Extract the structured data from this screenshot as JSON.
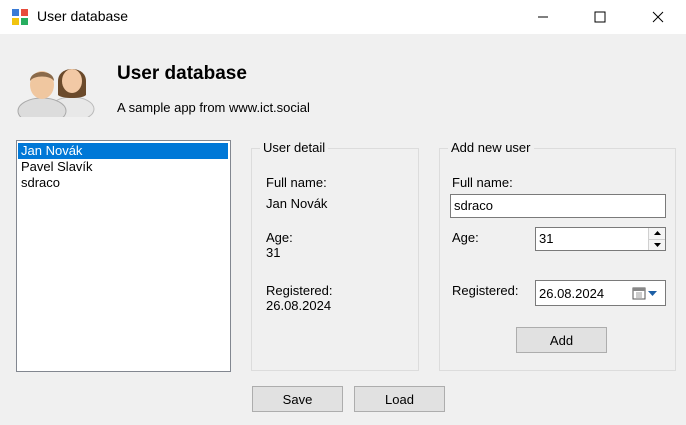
{
  "window": {
    "title": "User database",
    "controls": {
      "minimize": "minimize",
      "maximize": "maximize",
      "close": "close"
    }
  },
  "header": {
    "icon": "users-icon",
    "title": "User database",
    "subtitle": "A sample app from www.ict.social"
  },
  "user_list": {
    "items": [
      "Jan Novák",
      "Pavel Slavík",
      "sdraco"
    ],
    "selected_index": 0
  },
  "user_detail": {
    "legend": "User detail",
    "fullname_label": "Full name:",
    "fullname_value": "Jan Novák",
    "age_label": "Age:",
    "age_value": "31",
    "registered_label": "Registered:",
    "registered_value": "26.08.2024"
  },
  "add_user": {
    "legend": "Add new user",
    "fullname_label": "Full name:",
    "fullname_value": "sdraco",
    "age_label": "Age:",
    "age_value": "31",
    "registered_label": "Registered:",
    "registered_value": "26.08.2024",
    "add_label": "Add"
  },
  "buttons": {
    "save": "Save",
    "load": "Load"
  },
  "colors": {
    "selection": "#0078d7",
    "window_bg": "#f0f0f0",
    "button_bg": "#e1e1e1"
  }
}
